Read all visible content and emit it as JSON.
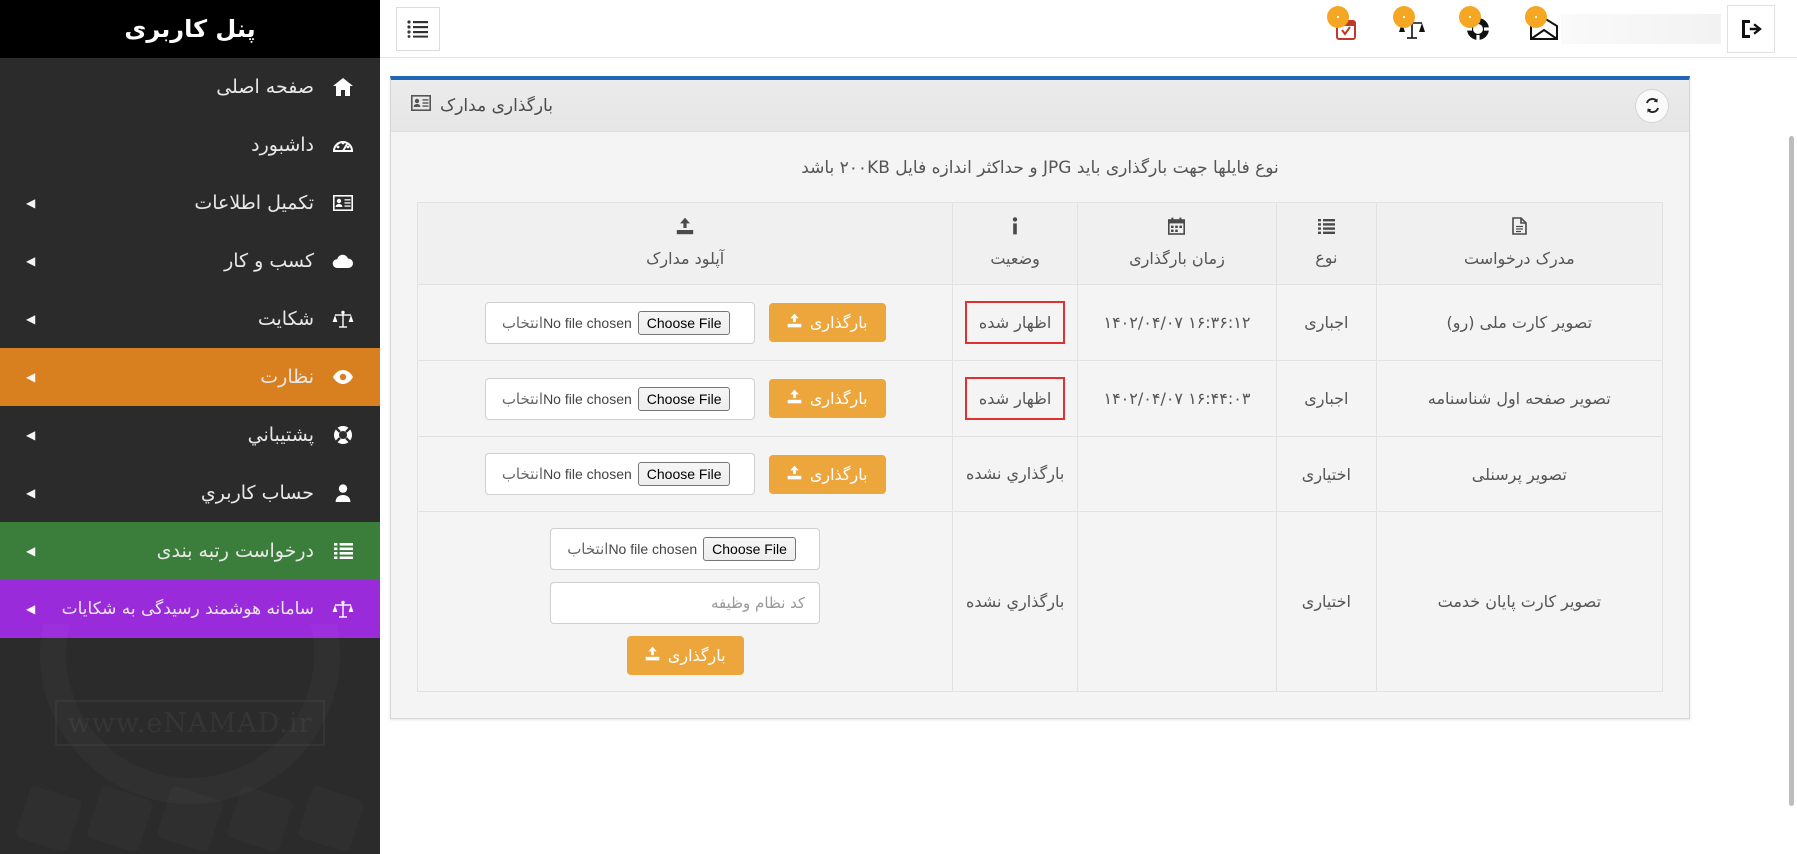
{
  "sidebar": {
    "brand": "پنل کاربری",
    "items": [
      {
        "label": "صفحه اصلی",
        "icon": "home-icon",
        "glyph": "⌂",
        "caret": false,
        "state": "default"
      },
      {
        "label": "داشبورد",
        "icon": "dashboard-icon",
        "glyph": "◔",
        "caret": false,
        "state": "default"
      },
      {
        "label": "تکمیل اطلاعات",
        "icon": "id-card-icon",
        "glyph": "▤",
        "caret": true,
        "state": "default"
      },
      {
        "label": "کسب و کار",
        "icon": "cloud-icon",
        "glyph": "☁",
        "caret": true,
        "state": "default"
      },
      {
        "label": "شکایت",
        "icon": "scales-icon",
        "glyph": "⚖",
        "caret": true,
        "state": "default"
      },
      {
        "label": "نظارت",
        "icon": "eye-icon",
        "glyph": "◉",
        "caret": true,
        "state": "orange"
      },
      {
        "label": "پشتیباني",
        "icon": "lifebuoy-icon",
        "glyph": "☉",
        "caret": true,
        "state": "default"
      },
      {
        "label": "حساب کاربري",
        "icon": "user-icon",
        "glyph": "♟",
        "caret": true,
        "state": "default"
      },
      {
        "label": "درخواست رتبه بندی",
        "icon": "list-icon",
        "glyph": "☰",
        "caret": true,
        "state": "green"
      },
      {
        "label": "سامانه هوشمند رسیدگی به شکایات",
        "icon": "scales-icon",
        "glyph": "⚖",
        "caret": true,
        "state": "purple"
      }
    ],
    "watermark": "www.eNAMAD.ir",
    "colors": {
      "orange": "#d8801f",
      "green": "#3b7d3b",
      "purple": "#9a2bdb",
      "base": "#2b2b2b"
    }
  },
  "topbar": {
    "logout_icon": "logout-icon",
    "hamburger_icon": "hamburger-menu-icon",
    "user_name": "",
    "icons": [
      {
        "name": "mail-icon",
        "badge": "۰"
      },
      {
        "name": "lifebuoy-icon",
        "badge": "۰"
      },
      {
        "name": "scales-icon",
        "badge": "۰"
      },
      {
        "name": "calendar-check-icon",
        "badge": "۰"
      }
    ]
  },
  "card": {
    "title": "بارگذاری مدارک",
    "title_icon": "id-card-icon",
    "refresh_icon": "refresh-icon",
    "accent_color": "#2265b5",
    "notice": "نوع فایلها جهت بارگذاری باید JPG و حداکثر اندازه فایل ۲۰۰KB باشد"
  },
  "table": {
    "headers": [
      {
        "label": "مدرک درخواست",
        "icon": "document-icon",
        "glyph": "὜E"
      },
      {
        "label": "نوع",
        "icon": "list-icon",
        "glyph": "☰"
      },
      {
        "label": "زمان بارگذاری",
        "icon": "calendar-icon",
        "glyph": "Ὄ5"
      },
      {
        "label": "وضعیت",
        "icon": "info-icon",
        "glyph": "i"
      },
      {
        "label": "آپلود مدارک",
        "icon": "upload-icon",
        "glyph": "⬆"
      }
    ],
    "rows": [
      {
        "document": "تصویر کارت ملی (رو)",
        "type": "اجباری",
        "time": "۱۴۰۲/۰۴/۰۷ ۱۶:۳۶:۱۲",
        "status": "اظهار شده",
        "status_boxed": true,
        "choose_label": "انتخاب",
        "choose_file_btn": "Choose File",
        "no_file_text": "No file chosen",
        "upload_btn": "بارگذاری",
        "extra_input": null
      },
      {
        "document": "تصویر صفحه اول شناسنامه",
        "type": "اجباری",
        "time": "۱۴۰۲/۰۴/۰۷ ۱۶:۴۴:۰۳",
        "status": "اظهار شده",
        "status_boxed": true,
        "choose_label": "انتخاب",
        "choose_file_btn": "Choose File",
        "no_file_text": "No file chosen",
        "upload_btn": "بارگذاری",
        "extra_input": null
      },
      {
        "document": "تصویر پرسنلی",
        "type": "اختیاری",
        "time": "",
        "status": "بارگذاري نشده",
        "status_boxed": false,
        "choose_label": "انتخاب",
        "choose_file_btn": "Choose File",
        "no_file_text": "No file chosen",
        "upload_btn": "بارگذاری",
        "extra_input": null
      },
      {
        "document": "تصویر کارت پایان خدمت",
        "type": "اختیاری",
        "time": "",
        "status": "بارگذاري نشده",
        "status_boxed": false,
        "choose_label": "انتخاب",
        "choose_file_btn": "Choose File",
        "no_file_text": "No file chosen",
        "upload_btn": "بارگذاری",
        "extra_input": {
          "placeholder": "کد نظام وظیفه",
          "value": ""
        }
      }
    ]
  }
}
